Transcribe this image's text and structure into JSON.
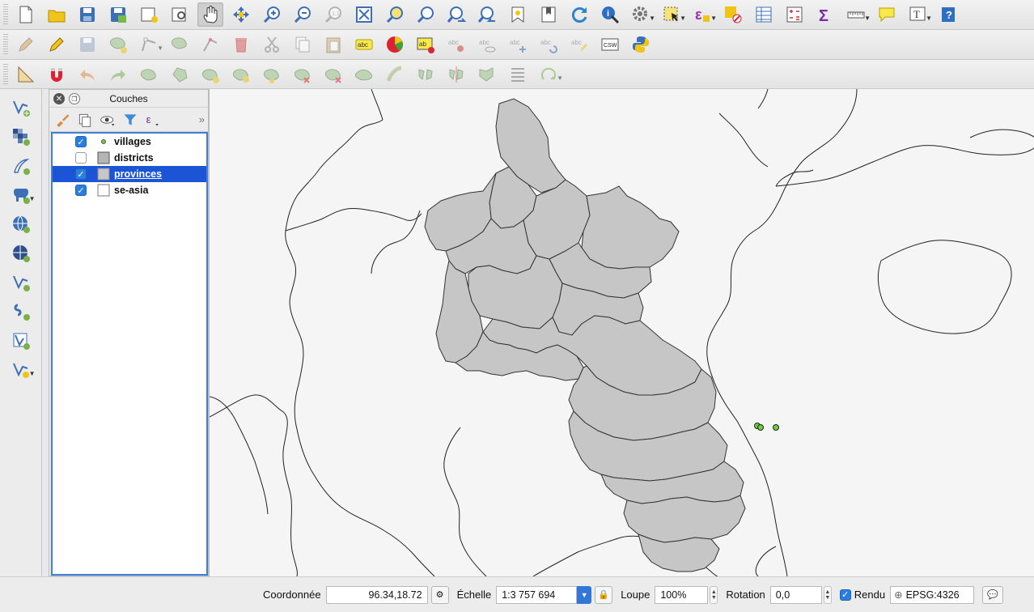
{
  "layers_panel": {
    "title": "Couches",
    "layers": [
      {
        "name": "villages",
        "checked": true,
        "symbol": "point",
        "selected": false
      },
      {
        "name": "districts",
        "checked": false,
        "symbol": "fill-gray",
        "selected": false
      },
      {
        "name": "provinces",
        "checked": true,
        "symbol": "fill-lightgray",
        "selected": true
      },
      {
        "name": "se-asia",
        "checked": true,
        "symbol": "fill-white",
        "selected": false
      }
    ]
  },
  "toolbar1": [
    "new-project-icon",
    "open-project-icon",
    "save-project-icon",
    "save-as-icon",
    "new-print-composer-icon",
    "composer-manager-icon",
    "pan-icon",
    "pan-to-selection-icon",
    "zoom-in-icon",
    "zoom-out-icon",
    "zoom-native-icon",
    "zoom-full-icon",
    "zoom-to-selection-icon",
    "zoom-to-layer-icon",
    "zoom-last-icon",
    "zoom-next-icon",
    "new-bookmark-icon",
    "show-bookmarks-icon",
    "refresh-icon",
    "identify-icon",
    "action-icon",
    "select-icon",
    "expression-select-icon",
    "deselect-icon",
    "attribute-table-icon",
    "field-calculator-icon",
    "statistics-icon",
    "measure-icon",
    "map-tips-icon",
    "text-annotation-icon",
    "help-icon"
  ],
  "toolbar2": [
    "edit-pencil-icon",
    "toggle-editing-icon",
    "save-edits-icon",
    "add-feature-icon",
    "node-tool-icon",
    "move-feature-icon",
    "delete-selected-icon",
    "cut-icon",
    "copy-icon",
    "paste-icon",
    "label-abc-icon",
    "diagram-icon",
    "layer-labeling-icon",
    "pin-labels-icon",
    "show-hide-labels-icon",
    "move-label-icon",
    "rotate-label-icon",
    "change-label-icon",
    "csw-icon",
    "python-icon"
  ],
  "toolbar3": [
    "measure-angle-icon",
    "snapping-icon",
    "undo-icon",
    "redo-icon",
    "rotate-feature-icon",
    "simplify-icon",
    "add-ring-icon",
    "add-part-icon",
    "fill-ring-icon",
    "delete-ring-icon",
    "delete-part-icon",
    "reshape-icon",
    "offset-curve-icon",
    "split-features-icon",
    "split-parts-icon",
    "merge-features-icon",
    "merge-attributes-icon",
    "rotate-symbols-icon"
  ],
  "left_toolbar": [
    "add-vector-layer-icon",
    "add-raster-layer-icon",
    "add-spatialite-layer-icon",
    "add-postgis-layer-icon",
    "add-wms-layer-icon",
    "add-wcs-layer-icon",
    "add-wfs-layer-icon",
    "add-delimited-text-icon",
    "add-virtual-layer-icon",
    "new-shapefile-icon"
  ],
  "status_bar": {
    "coord_label": "Coordonnée",
    "coord_value": "96.34,18.72",
    "scale_label": "Échelle",
    "scale_value": "1:3 757 694",
    "magnifier_label": "Loupe",
    "magnifier_value": "100%",
    "rotation_label": "Rotation",
    "rotation_value": "0,0",
    "render_label": "Rendu",
    "render_checked": true,
    "crs_label": "EPSG:4326"
  },
  "colors": {
    "selection": "#1b55d6",
    "province_fill": "#c6c6c6",
    "map_background": "#f5f5f5",
    "village_point": "#6fcf3b"
  }
}
